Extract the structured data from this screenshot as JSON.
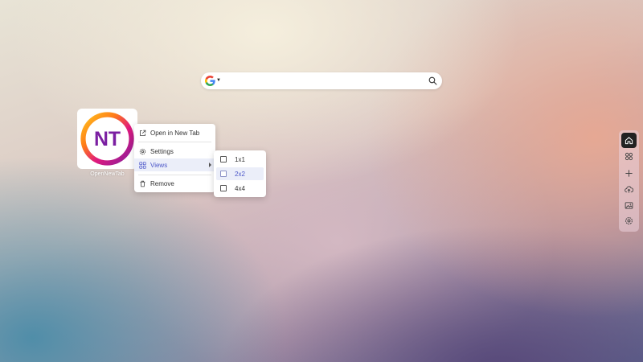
{
  "search": {
    "placeholder": "",
    "value": "",
    "engine_icon": "google-icon"
  },
  "shortcut": {
    "logo_text": "NT",
    "label": "OpenNewTab"
  },
  "context_menu": {
    "items": [
      {
        "label": "Open in New Tab",
        "icon": "open-external-icon"
      },
      {
        "label": "Settings",
        "icon": "gear-icon"
      },
      {
        "label": "Views",
        "icon": "grid-icon",
        "has_submenu": true,
        "active": true
      },
      {
        "label": "Remove",
        "icon": "trash-icon"
      }
    ]
  },
  "views_submenu": {
    "options": [
      {
        "label": "1x1",
        "checked": false
      },
      {
        "label": "2x2",
        "checked": false,
        "highlighted": true
      },
      {
        "label": "4x4",
        "checked": false
      }
    ]
  },
  "dock": {
    "buttons": [
      "home-icon",
      "apps-icon",
      "plus-icon",
      "cloud-upload-icon",
      "image-icon",
      "gear-icon"
    ],
    "active": "home-icon"
  },
  "colors": {
    "accent": "#4c57c9",
    "logo_text": "#7b1fa2"
  }
}
